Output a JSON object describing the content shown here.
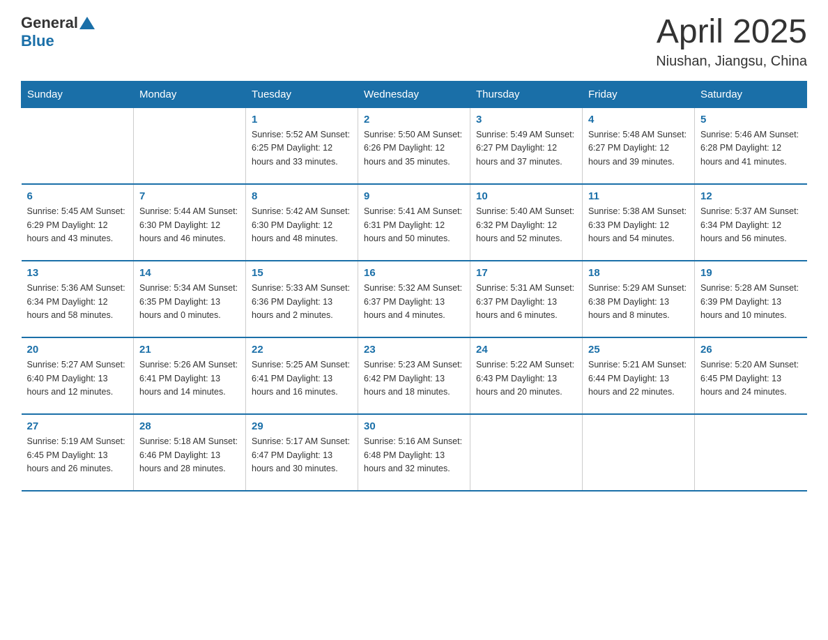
{
  "logo": {
    "general": "General",
    "blue": "Blue"
  },
  "title": "April 2025",
  "location": "Niushan, Jiangsu, China",
  "days_header": [
    "Sunday",
    "Monday",
    "Tuesday",
    "Wednesday",
    "Thursday",
    "Friday",
    "Saturday"
  ],
  "weeks": [
    [
      {
        "day": "",
        "info": ""
      },
      {
        "day": "",
        "info": ""
      },
      {
        "day": "1",
        "info": "Sunrise: 5:52 AM\nSunset: 6:25 PM\nDaylight: 12 hours\nand 33 minutes."
      },
      {
        "day": "2",
        "info": "Sunrise: 5:50 AM\nSunset: 6:26 PM\nDaylight: 12 hours\nand 35 minutes."
      },
      {
        "day": "3",
        "info": "Sunrise: 5:49 AM\nSunset: 6:27 PM\nDaylight: 12 hours\nand 37 minutes."
      },
      {
        "day": "4",
        "info": "Sunrise: 5:48 AM\nSunset: 6:27 PM\nDaylight: 12 hours\nand 39 minutes."
      },
      {
        "day": "5",
        "info": "Sunrise: 5:46 AM\nSunset: 6:28 PM\nDaylight: 12 hours\nand 41 minutes."
      }
    ],
    [
      {
        "day": "6",
        "info": "Sunrise: 5:45 AM\nSunset: 6:29 PM\nDaylight: 12 hours\nand 43 minutes."
      },
      {
        "day": "7",
        "info": "Sunrise: 5:44 AM\nSunset: 6:30 PM\nDaylight: 12 hours\nand 46 minutes."
      },
      {
        "day": "8",
        "info": "Sunrise: 5:42 AM\nSunset: 6:30 PM\nDaylight: 12 hours\nand 48 minutes."
      },
      {
        "day": "9",
        "info": "Sunrise: 5:41 AM\nSunset: 6:31 PM\nDaylight: 12 hours\nand 50 minutes."
      },
      {
        "day": "10",
        "info": "Sunrise: 5:40 AM\nSunset: 6:32 PM\nDaylight: 12 hours\nand 52 minutes."
      },
      {
        "day": "11",
        "info": "Sunrise: 5:38 AM\nSunset: 6:33 PM\nDaylight: 12 hours\nand 54 minutes."
      },
      {
        "day": "12",
        "info": "Sunrise: 5:37 AM\nSunset: 6:34 PM\nDaylight: 12 hours\nand 56 minutes."
      }
    ],
    [
      {
        "day": "13",
        "info": "Sunrise: 5:36 AM\nSunset: 6:34 PM\nDaylight: 12 hours\nand 58 minutes."
      },
      {
        "day": "14",
        "info": "Sunrise: 5:34 AM\nSunset: 6:35 PM\nDaylight: 13 hours\nand 0 minutes."
      },
      {
        "day": "15",
        "info": "Sunrise: 5:33 AM\nSunset: 6:36 PM\nDaylight: 13 hours\nand 2 minutes."
      },
      {
        "day": "16",
        "info": "Sunrise: 5:32 AM\nSunset: 6:37 PM\nDaylight: 13 hours\nand 4 minutes."
      },
      {
        "day": "17",
        "info": "Sunrise: 5:31 AM\nSunset: 6:37 PM\nDaylight: 13 hours\nand 6 minutes."
      },
      {
        "day": "18",
        "info": "Sunrise: 5:29 AM\nSunset: 6:38 PM\nDaylight: 13 hours\nand 8 minutes."
      },
      {
        "day": "19",
        "info": "Sunrise: 5:28 AM\nSunset: 6:39 PM\nDaylight: 13 hours\nand 10 minutes."
      }
    ],
    [
      {
        "day": "20",
        "info": "Sunrise: 5:27 AM\nSunset: 6:40 PM\nDaylight: 13 hours\nand 12 minutes."
      },
      {
        "day": "21",
        "info": "Sunrise: 5:26 AM\nSunset: 6:41 PM\nDaylight: 13 hours\nand 14 minutes."
      },
      {
        "day": "22",
        "info": "Sunrise: 5:25 AM\nSunset: 6:41 PM\nDaylight: 13 hours\nand 16 minutes."
      },
      {
        "day": "23",
        "info": "Sunrise: 5:23 AM\nSunset: 6:42 PM\nDaylight: 13 hours\nand 18 minutes."
      },
      {
        "day": "24",
        "info": "Sunrise: 5:22 AM\nSunset: 6:43 PM\nDaylight: 13 hours\nand 20 minutes."
      },
      {
        "day": "25",
        "info": "Sunrise: 5:21 AM\nSunset: 6:44 PM\nDaylight: 13 hours\nand 22 minutes."
      },
      {
        "day": "26",
        "info": "Sunrise: 5:20 AM\nSunset: 6:45 PM\nDaylight: 13 hours\nand 24 minutes."
      }
    ],
    [
      {
        "day": "27",
        "info": "Sunrise: 5:19 AM\nSunset: 6:45 PM\nDaylight: 13 hours\nand 26 minutes."
      },
      {
        "day": "28",
        "info": "Sunrise: 5:18 AM\nSunset: 6:46 PM\nDaylight: 13 hours\nand 28 minutes."
      },
      {
        "day": "29",
        "info": "Sunrise: 5:17 AM\nSunset: 6:47 PM\nDaylight: 13 hours\nand 30 minutes."
      },
      {
        "day": "30",
        "info": "Sunrise: 5:16 AM\nSunset: 6:48 PM\nDaylight: 13 hours\nand 32 minutes."
      },
      {
        "day": "",
        "info": ""
      },
      {
        "day": "",
        "info": ""
      },
      {
        "day": "",
        "info": ""
      }
    ]
  ]
}
